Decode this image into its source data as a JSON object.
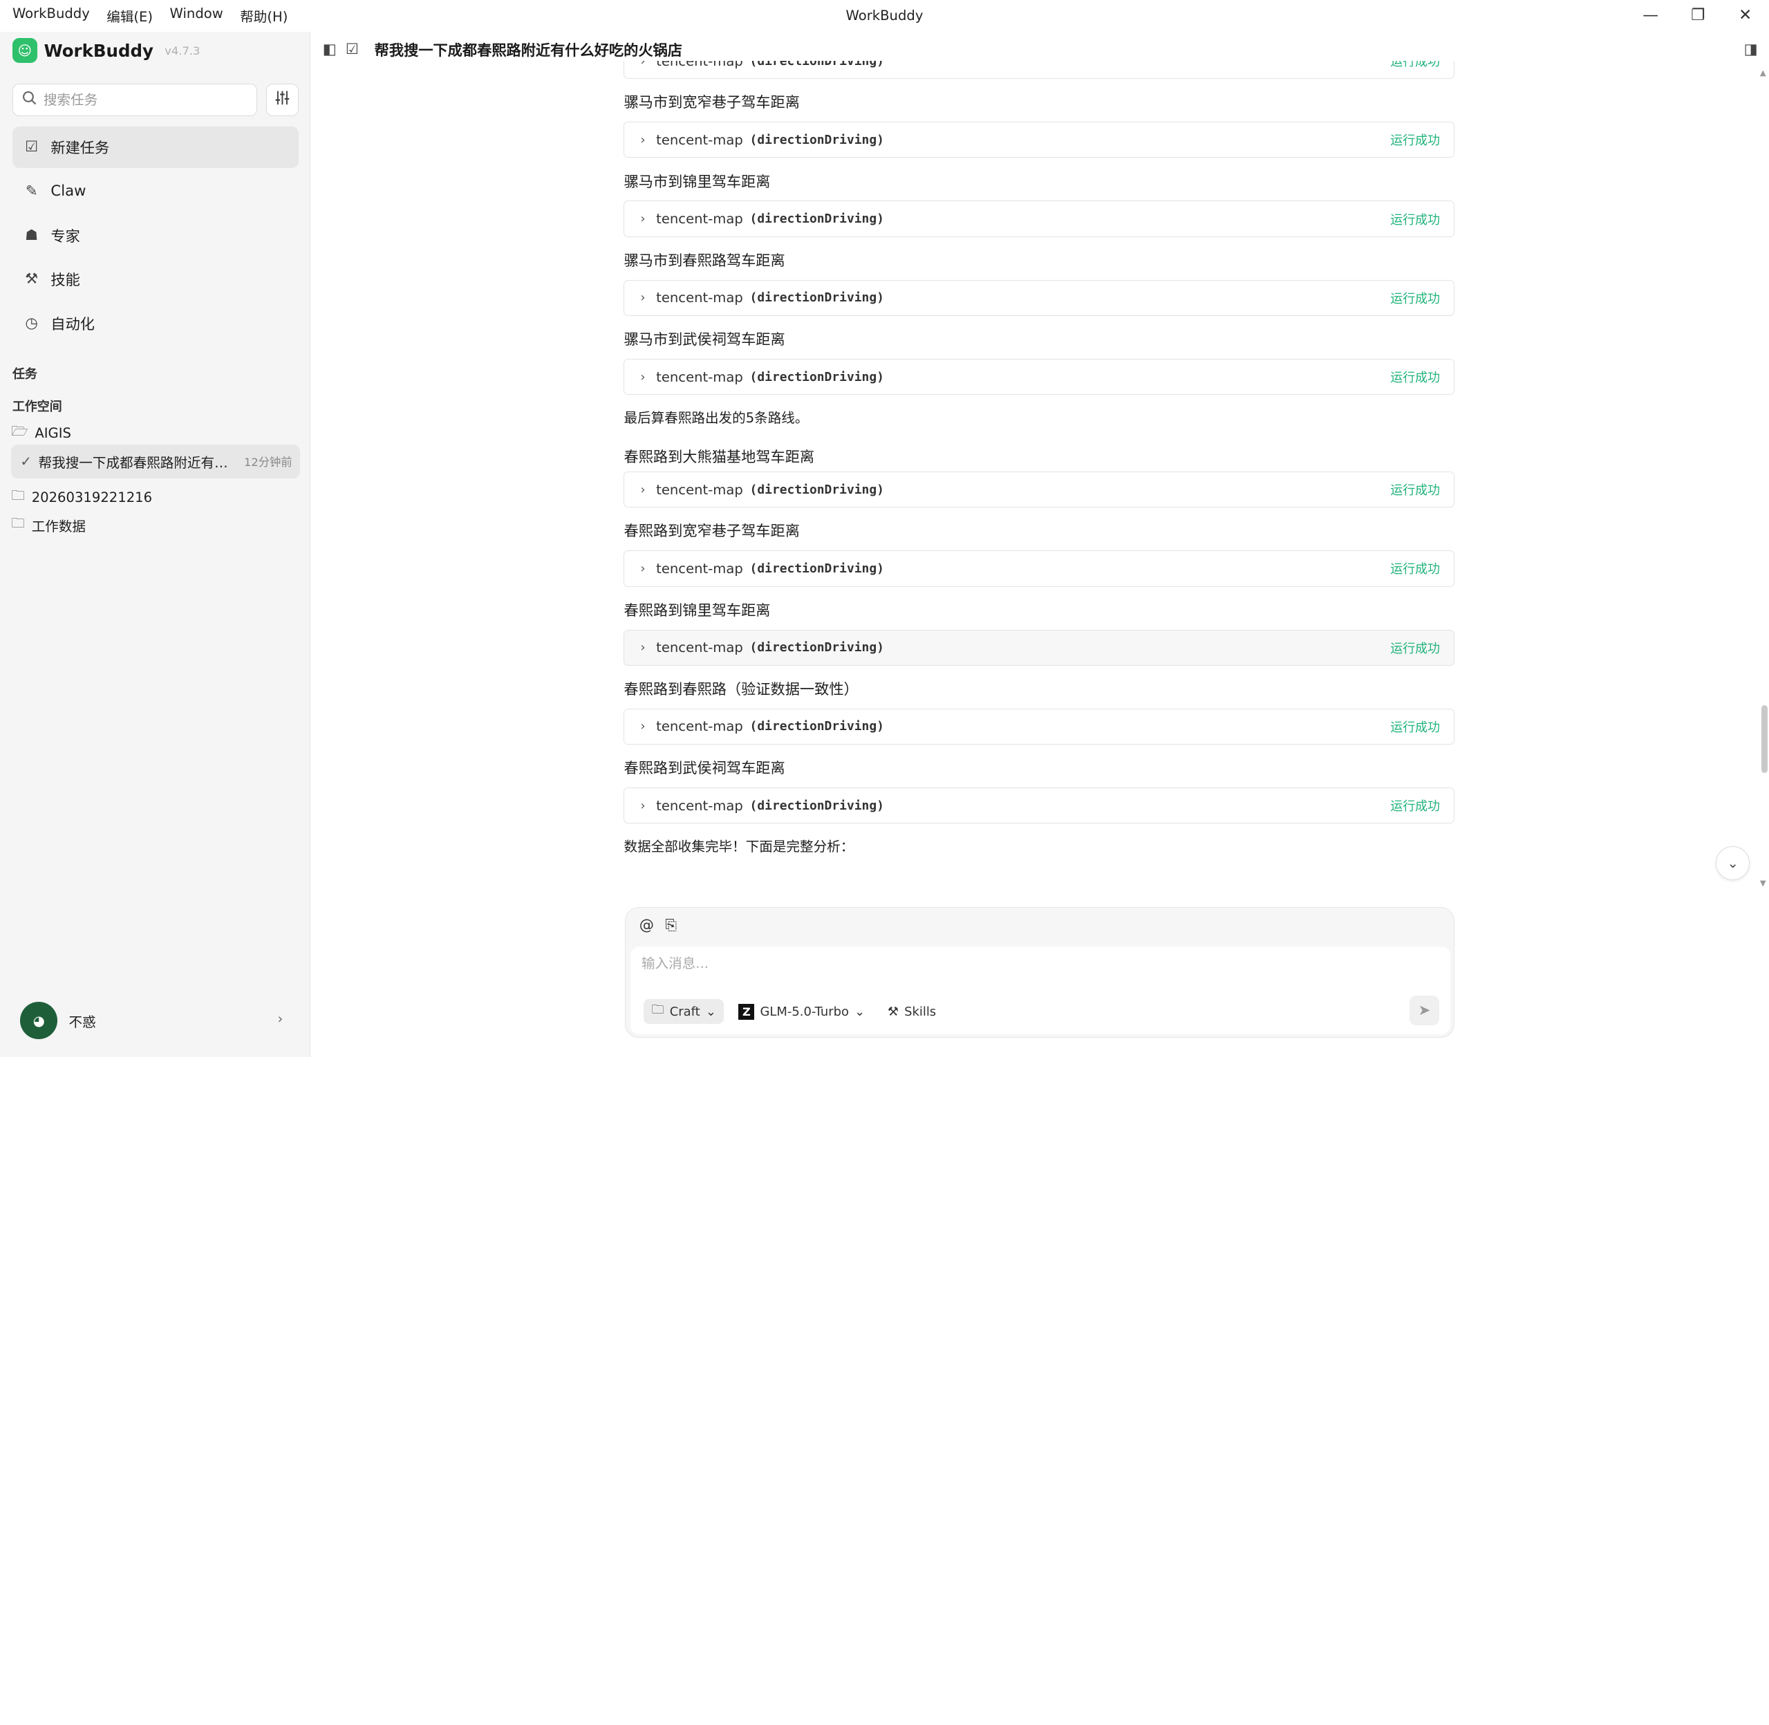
{
  "window": {
    "title": "WorkBuddy",
    "menu": [
      "WorkBuddy",
      "编辑(E)",
      "Window",
      "帮助(H)"
    ],
    "controls": {
      "minimize": "—",
      "restore": "❐",
      "close": "✕"
    }
  },
  "sidebar": {
    "brand": {
      "name": "WorkBuddy",
      "version": "v4.7.3"
    },
    "search": {
      "placeholder": "搜索任务"
    },
    "nav": [
      {
        "label": "新建任务",
        "icon": "new-task-icon"
      },
      {
        "label": "Claw",
        "icon": "claw-icon"
      },
      {
        "label": "专家",
        "icon": "expert-icon"
      },
      {
        "label": "技能",
        "icon": "skills-icon"
      },
      {
        "label": "自动化",
        "icon": "clock-icon"
      }
    ],
    "tasks_label": "任务",
    "workspace_label": "工作空间",
    "folders": [
      {
        "name": "AIGIS"
      },
      {
        "name": "20260319221216"
      },
      {
        "name": "工作数据"
      }
    ],
    "active_task": {
      "title": "帮我搜一下成都春熙路附近有什么好吃的火锅店",
      "time": "12分钟前"
    },
    "user": {
      "name": "不惑"
    }
  },
  "main": {
    "title": "帮我搜一下成都春熙路附近有什么好吃的火锅店",
    "tool_name": "tencent-map",
    "tool_method": "(directionDriving)",
    "status_text": "运行成功",
    "steps": [
      {
        "title": "骡马市到宽窄巷子驾车距离"
      },
      {
        "title": "骡马市到锦里驾车距离"
      },
      {
        "title": "骡马市到春熙路驾车距离"
      },
      {
        "title": "骡马市到武侯祠驾车距离"
      }
    ],
    "note_1": "最后算春熙路出发的5条路线。",
    "steps2": [
      {
        "title": "春熙路到大熊猫基地驾车距离"
      },
      {
        "title": "春熙路到宽窄巷子驾车距离"
      },
      {
        "title": "春熙路到锦里驾车距离"
      },
      {
        "title": "春熙路到春熙路（验证数据一致性）"
      },
      {
        "title": "春熙路到武侯祠驾车距离"
      }
    ],
    "note_2": "数据全部收集完毕！下面是完整分析："
  },
  "composer": {
    "placeholder": "输入消息...",
    "mode": "Craft",
    "model": "GLM-5.0-Turbo",
    "skills": "Skills"
  },
  "colors": {
    "success": "#20b37b",
    "brand": "#2fc06b"
  }
}
